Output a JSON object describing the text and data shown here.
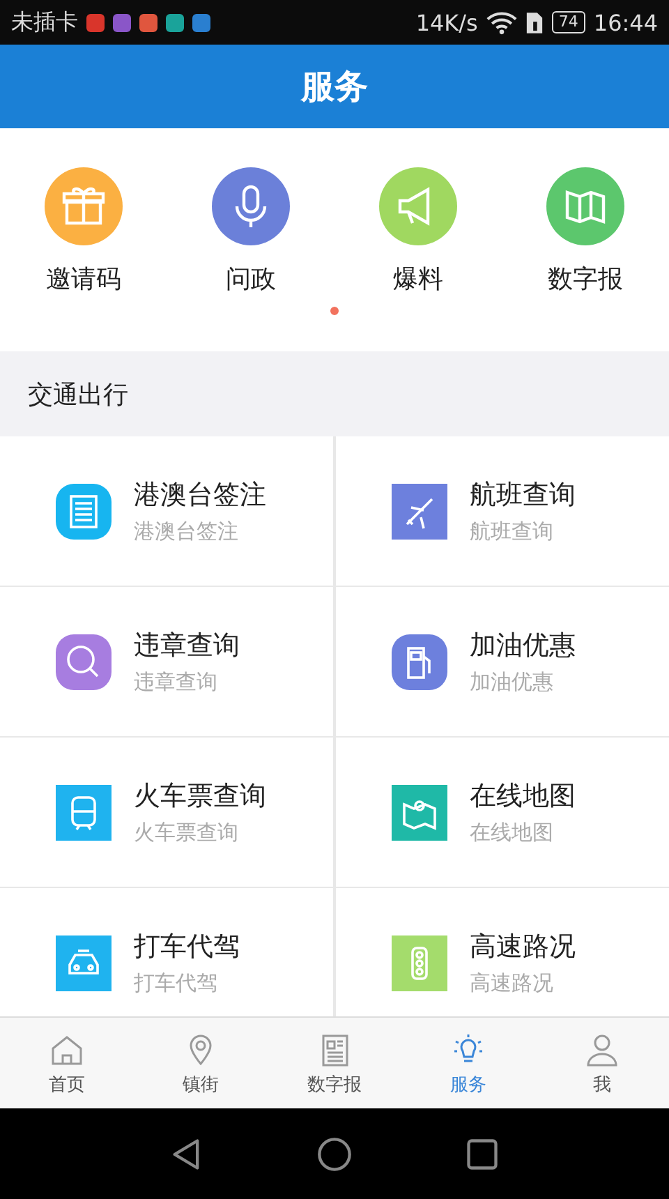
{
  "status_bar": {
    "carrier": "未插卡",
    "speed": "14K/s",
    "battery": "74",
    "time": "16:44"
  },
  "header": {
    "title": "服务"
  },
  "quick_actions": [
    {
      "label": "邀请码",
      "color": "#fbb042"
    },
    {
      "label": "问政",
      "color": "#6b80d9"
    },
    {
      "label": "爆料",
      "color": "#a0d860"
    },
    {
      "label": "数字报",
      "color": "#5cc76d"
    }
  ],
  "page_dots": [
    {
      "selected": true
    }
  ],
  "section": {
    "title": "交通出行"
  },
  "services": [
    {
      "title": "港澳台签注",
      "subtitle": "港澳台签注",
      "color": "#17b5f0",
      "kind": "rounded"
    },
    {
      "title": "航班查询",
      "subtitle": "航班查询",
      "color": "#6d80dd",
      "kind": "square"
    },
    {
      "title": "违章查询",
      "subtitle": "违章查询",
      "color": "#a77de0",
      "kind": "rounded"
    },
    {
      "title": "加油优惠",
      "subtitle": "加油优惠",
      "color": "#6d80dd",
      "kind": "rounded"
    },
    {
      "title": "火车票查询",
      "subtitle": "火车票查询",
      "color": "#1fb3ef",
      "kind": "square"
    },
    {
      "title": "在线地图",
      "subtitle": "在线地图",
      "color": "#1fb9a7",
      "kind": "square"
    },
    {
      "title": "打车代驾",
      "subtitle": "打车代驾",
      "color": "#1fb3ef",
      "kind": "square"
    },
    {
      "title": "高速路况",
      "subtitle": "高速路况",
      "color": "#a4dc6c",
      "kind": "square"
    }
  ],
  "tabs": [
    {
      "label": "首页",
      "selected": false
    },
    {
      "label": "镇街",
      "selected": false
    },
    {
      "label": "数字报",
      "selected": false
    },
    {
      "label": "服务",
      "selected": true
    },
    {
      "label": "我",
      "selected": false
    }
  ]
}
